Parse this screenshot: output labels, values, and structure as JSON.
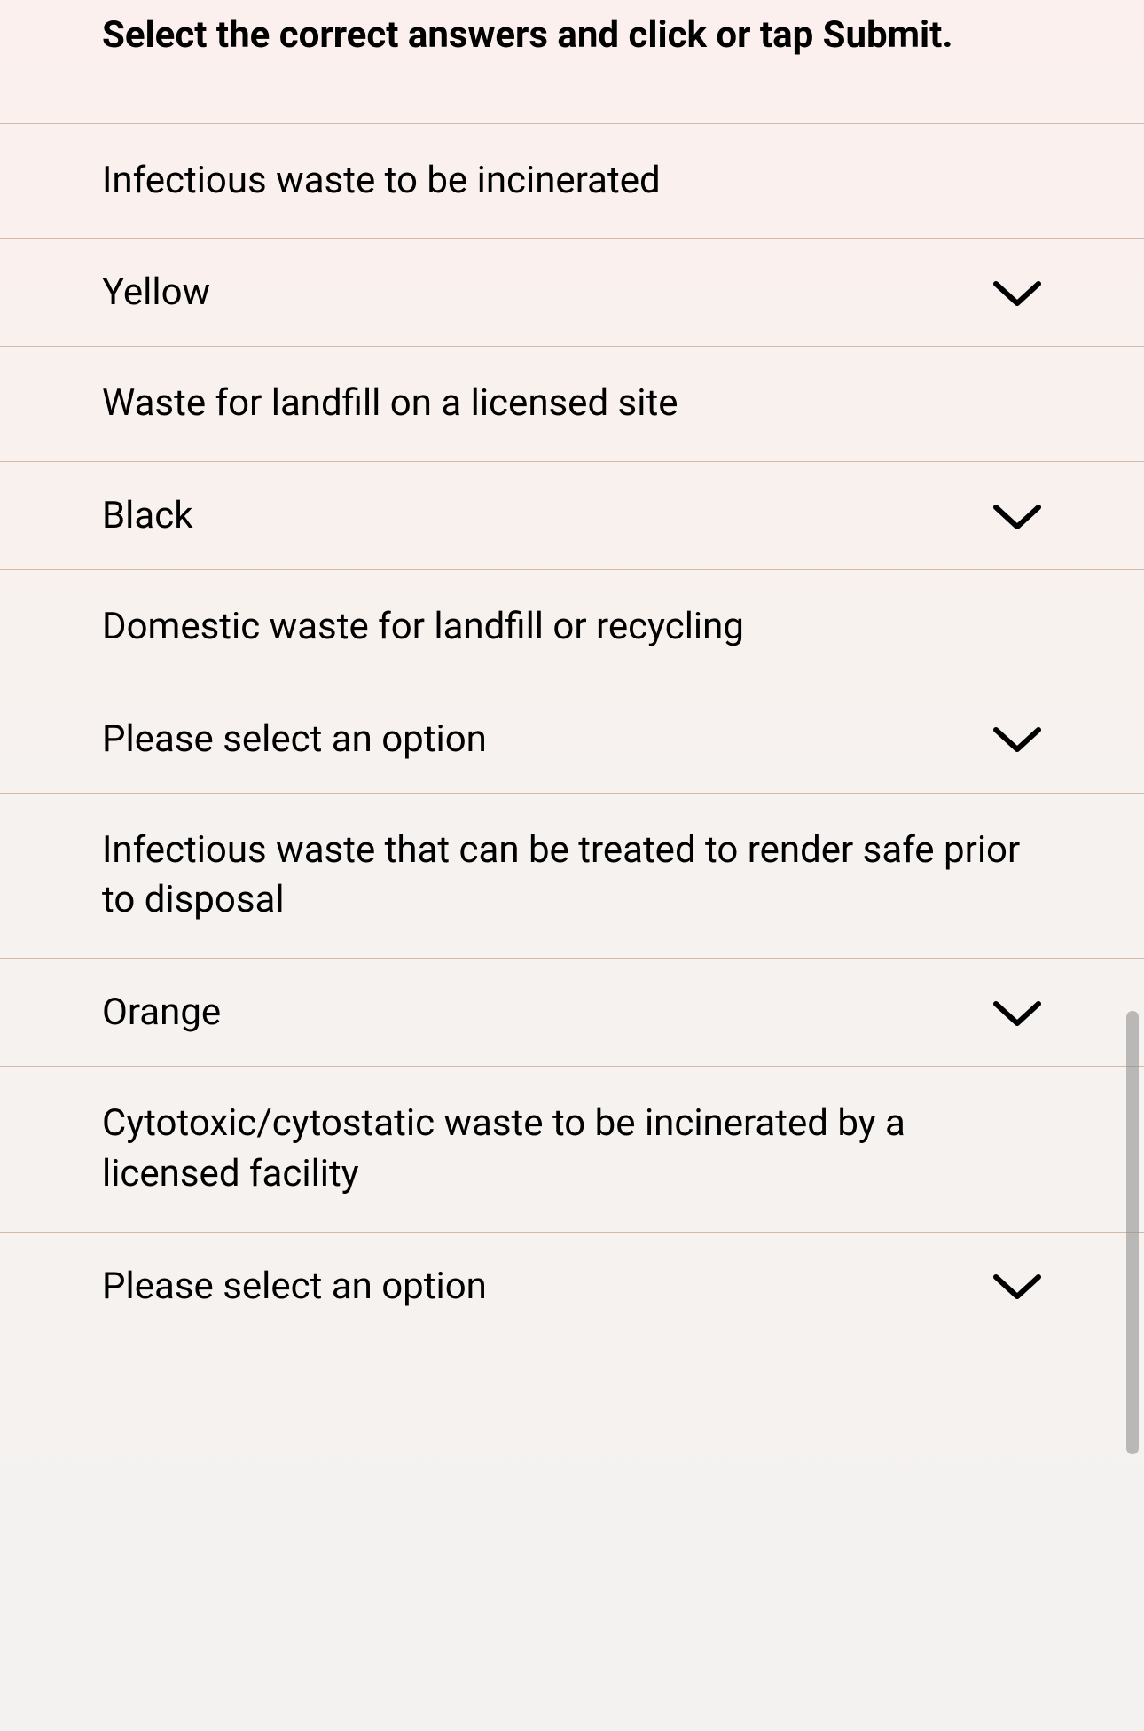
{
  "instruction": "Select the correct answers and click or tap Submit.",
  "items": [
    {
      "question": "Infectious waste to be incinerated",
      "selected": "Yellow"
    },
    {
      "question": "Waste for landfill on a licensed site",
      "selected": "Black"
    },
    {
      "question": "Domestic waste for landfill or recycling",
      "selected": "Please select an option"
    },
    {
      "question": "Infectious waste that can be treated to render safe prior to disposal",
      "selected": "Orange"
    },
    {
      "question": "Cytotoxic/cytostatic waste to be incinerated by a licensed facility",
      "selected": "Please select an option"
    }
  ]
}
